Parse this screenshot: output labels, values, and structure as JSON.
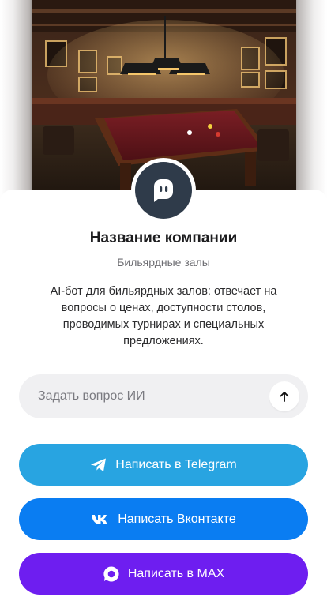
{
  "company": {
    "name": "Название компании",
    "category": "Бильярдные залы",
    "description": "AI-бот для бильярдных залов: отвечает на вопросы о ценах, доступности столов, проводимых турнирах и специальных предложениях."
  },
  "hero": {
    "image_icon": "billiard-room-photo"
  },
  "avatar": {
    "icon": "chat-bubble-face-icon",
    "color": "#2f3b4a"
  },
  "ask": {
    "placeholder": "Задать вопрос ИИ",
    "send_icon": "arrow-up-icon"
  },
  "buttons": {
    "telegram": {
      "label": "Написать в Telegram",
      "icon": "telegram-icon",
      "color": "#28a4e1"
    },
    "vk": {
      "label": "Написать Вконтакте",
      "icon": "vk-icon",
      "color": "#0a7df2"
    },
    "max": {
      "label": "Написать в MAX",
      "icon": "max-icon",
      "color": "#6e1ef0"
    }
  }
}
